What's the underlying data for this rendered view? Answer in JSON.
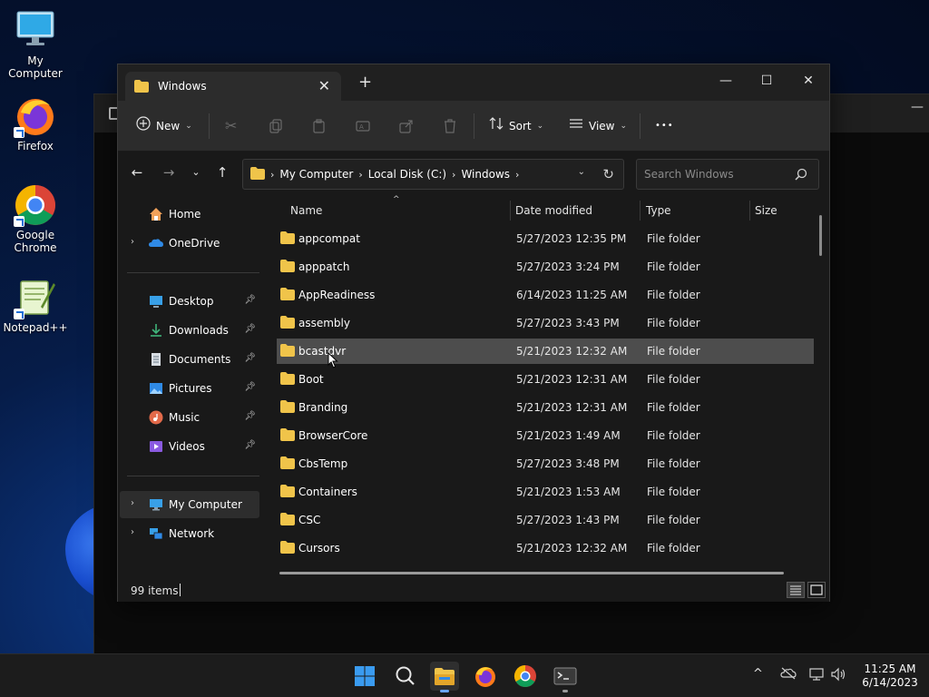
{
  "desktop": {
    "icons": [
      {
        "label": "My Computer"
      },
      {
        "label": "Firefox"
      },
      {
        "label": "Google Chrome"
      },
      {
        "label": "Notepad++"
      }
    ]
  },
  "window": {
    "tab_title": "Windows",
    "minimize_glyph": "—",
    "maximize_glyph": "☐",
    "close_glyph": "✕",
    "new_tab_glyph": "+",
    "tab_close_glyph": "✕"
  },
  "toolbar": {
    "new_label": "New",
    "sort_label": "Sort",
    "view_label": "View",
    "more_glyph": "•••"
  },
  "address": {
    "crumbs": [
      "My Computer",
      "Local Disk (C:)",
      "Windows"
    ]
  },
  "search": {
    "placeholder": "Search Windows"
  },
  "nav": {
    "home": "Home",
    "onedrive": "OneDrive",
    "desktop": "Desktop",
    "downloads": "Downloads",
    "documents": "Documents",
    "pictures": "Pictures",
    "music": "Music",
    "videos": "Videos",
    "my_computer": "My Computer",
    "network": "Network"
  },
  "columns": {
    "name": "Name",
    "date": "Date modified",
    "type": "Type",
    "size": "Size"
  },
  "files": [
    {
      "name": "appcompat",
      "date": "5/27/2023 12:35 PM",
      "type": "File folder"
    },
    {
      "name": "apppatch",
      "date": "5/27/2023 3:24 PM",
      "type": "File folder"
    },
    {
      "name": "AppReadiness",
      "date": "6/14/2023 11:25 AM",
      "type": "File folder"
    },
    {
      "name": "assembly",
      "date": "5/27/2023 3:43 PM",
      "type": "File folder"
    },
    {
      "name": "bcastdvr",
      "date": "5/21/2023 12:32 AM",
      "type": "File folder"
    },
    {
      "name": "Boot",
      "date": "5/21/2023 12:31 AM",
      "type": "File folder"
    },
    {
      "name": "Branding",
      "date": "5/21/2023 12:31 AM",
      "type": "File folder"
    },
    {
      "name": "BrowserCore",
      "date": "5/21/2023 1:49 AM",
      "type": "File folder"
    },
    {
      "name": "CbsTemp",
      "date": "5/27/2023 3:48 PM",
      "type": "File folder"
    },
    {
      "name": "Containers",
      "date": "5/21/2023 1:53 AM",
      "type": "File folder"
    },
    {
      "name": "CSC",
      "date": "5/27/2023 1:43 PM",
      "type": "File folder"
    },
    {
      "name": "Cursors",
      "date": "5/21/2023 12:32 AM",
      "type": "File folder"
    }
  ],
  "status": {
    "item_count": "99 items"
  },
  "taskbar": {
    "time": "11:25 AM",
    "date": "6/14/2023"
  },
  "colors": {
    "accent": "#6aa6ff",
    "folder": "#f0c44a",
    "window_bg": "#191919",
    "toolbar_bg": "#2c2c2c"
  }
}
